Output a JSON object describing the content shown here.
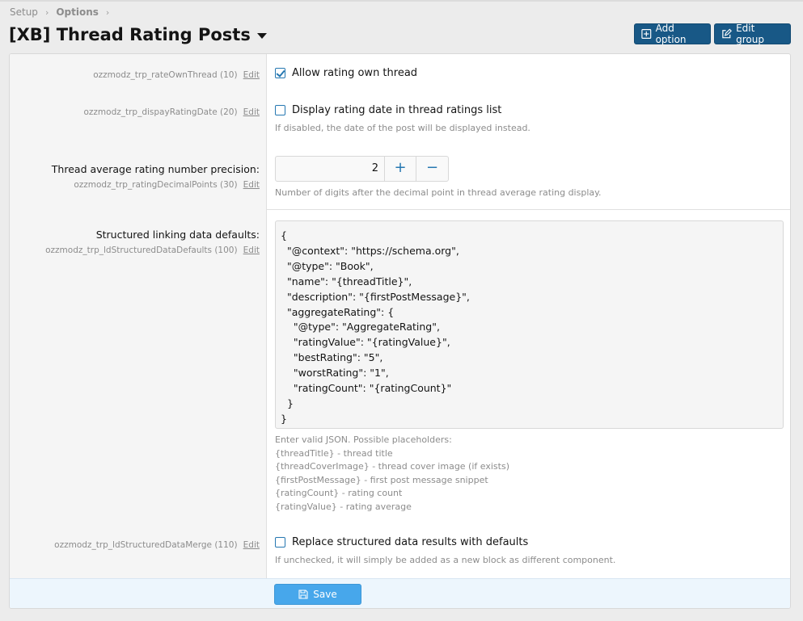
{
  "breadcrumb": {
    "items": [
      "Setup",
      "Options"
    ]
  },
  "page": {
    "title": "[XB] Thread Rating Posts"
  },
  "actions": {
    "add_option": "Add option",
    "edit_group": "Edit group"
  },
  "colors": {
    "primary": "#185886",
    "accent": "#2577b1",
    "save": "#47a7eb"
  },
  "options": [
    {
      "key": "ozzmodz_trp_rateOwnThread (10)",
      "edit": "Edit",
      "type": "checkbox",
      "checked": true,
      "label": "Allow rating own thread"
    },
    {
      "key": "ozzmodz_trp_dispayRatingDate (20)",
      "edit": "Edit",
      "type": "checkbox",
      "checked": false,
      "label": "Display rating date in thread ratings list",
      "hint": "If disabled, the date of the post will be displayed instead."
    },
    {
      "title": "Thread average rating number precision:",
      "key": "ozzmodz_trp_ratingDecimalPoints (30)",
      "edit": "Edit",
      "type": "number",
      "value": "2",
      "plus": "+",
      "minus": "−",
      "hint": "Number of digits after the decimal point in thread average rating display."
    },
    {
      "title": "Structured linking data defaults:",
      "key": "ozzmodz_trp_ldStructuredDataDefaults (100)",
      "edit": "Edit",
      "type": "textarea",
      "value": "{\n  \"@context\": \"https://schema.org\",\n  \"@type\": \"Book\",\n  \"name\": \"{threadTitle}\",\n  \"description\": \"{firstPostMessage}\",\n  \"aggregateRating\": {\n    \"@type\": \"AggregateRating\",\n    \"ratingValue\": \"{ratingValue}\",\n    \"bestRating\": \"5\",\n    \"worstRating\": \"1\",\n    \"ratingCount\": \"{ratingCount}\"\n  }\n}",
      "hint_lines": [
        "Enter valid JSON. Possible placeholders:",
        "{threadTitle} - thread title",
        "{threadCoverImage} - thread cover image (if exists)",
        "{firstPostMessage} - first post message snippet",
        "{ratingCount} - rating count",
        "{ratingValue} - rating average"
      ]
    },
    {
      "key": "ozzmodz_trp_ldStructuredDataMerge (110)",
      "edit": "Edit",
      "type": "checkbox",
      "checked": false,
      "label": "Replace structured data results with defaults",
      "hint": "If unchecked, it will simply be added as a new block as different component."
    }
  ],
  "footer": {
    "save_label": "Save"
  }
}
